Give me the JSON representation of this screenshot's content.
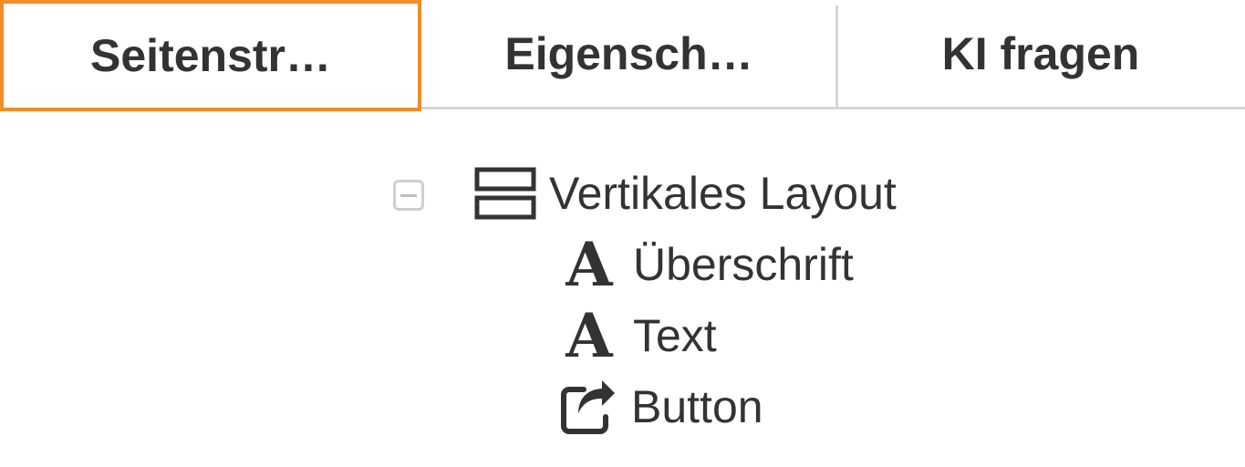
{
  "tabs": [
    {
      "label": "Seitenstr…",
      "active": true
    },
    {
      "label": "Eigensch…",
      "active": false
    },
    {
      "label": "KI fragen",
      "active": false
    }
  ],
  "tree": {
    "root": {
      "label": "Vertikales Layout",
      "icon": "vertical-layout-icon",
      "expanded": true
    },
    "children": [
      {
        "label": "Überschrift",
        "icon": "font-icon"
      },
      {
        "label": "Text",
        "icon": "font-icon"
      },
      {
        "label": "Button",
        "icon": "share-icon"
      }
    ]
  },
  "colors": {
    "active_tab_border": "#f28c28",
    "text": "#333333",
    "divider": "#d6d6d6"
  }
}
